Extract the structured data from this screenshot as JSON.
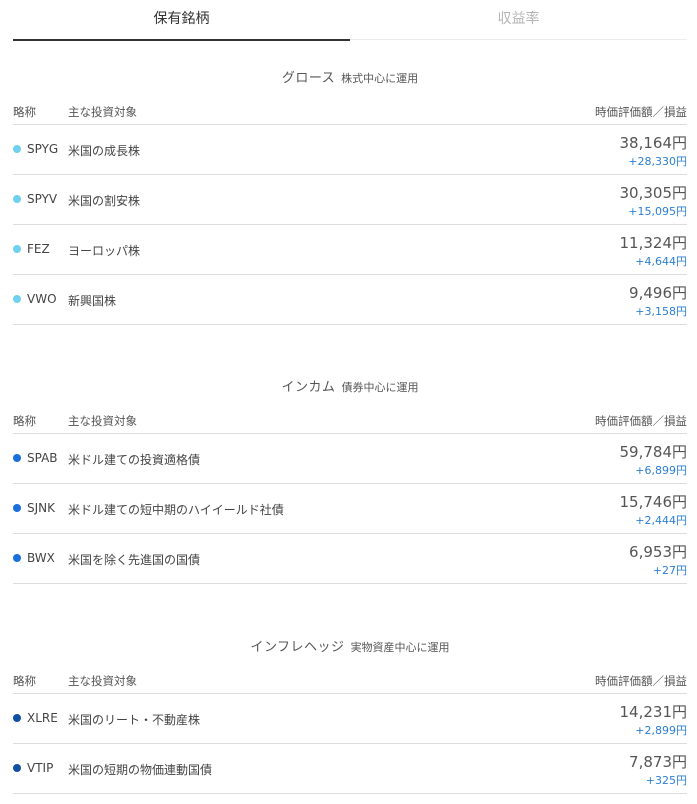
{
  "tabs": [
    {
      "label": "保有銘柄",
      "active": true
    },
    {
      "label": "収益率",
      "active": false
    }
  ],
  "columns": {
    "short_name": "略称",
    "target": "主な投資対象",
    "value_gain": "時価評価額／損益"
  },
  "colors": {
    "growth": "#6fd0f0",
    "income": "#1a6fdc",
    "hedge": "#114fa3",
    "gain": "#2b7fd6"
  },
  "sections": [
    {
      "title": "グロース",
      "subtitle": "株式中心に運用",
      "holdings": [
        {
          "ticker": "SPYG",
          "target": "米国の成長株",
          "value": "38,164円",
          "gain": "+28,330円"
        },
        {
          "ticker": "SPYV",
          "target": "米国の割安株",
          "value": "30,305円",
          "gain": "+15,095円"
        },
        {
          "ticker": "FEZ",
          "target": "ヨーロッパ株",
          "value": "11,324円",
          "gain": "+4,644円"
        },
        {
          "ticker": "VWO",
          "target": "新興国株",
          "value": "9,496円",
          "gain": "+3,158円"
        }
      ]
    },
    {
      "title": "インカム",
      "subtitle": "債券中心に運用",
      "holdings": [
        {
          "ticker": "SPAB",
          "target": "米ドル建ての投資適格債",
          "value": "59,784円",
          "gain": "+6,899円"
        },
        {
          "ticker": "SJNK",
          "target": "米ドル建ての短中期のハイイールド社債",
          "value": "15,746円",
          "gain": "+2,444円"
        },
        {
          "ticker": "BWX",
          "target": "米国を除く先進国の国債",
          "value": "6,953円",
          "gain": "+27円"
        }
      ]
    },
    {
      "title": "インフレヘッジ",
      "subtitle": "実物資産中心に運用",
      "holdings": [
        {
          "ticker": "XLRE",
          "target": "米国のリート・不動産株",
          "value": "14,231円",
          "gain": "+2,899円"
        },
        {
          "ticker": "VTIP",
          "target": "米国の短期の物価連動国債",
          "value": "7,873円",
          "gain": "+325円"
        }
      ]
    }
  ]
}
